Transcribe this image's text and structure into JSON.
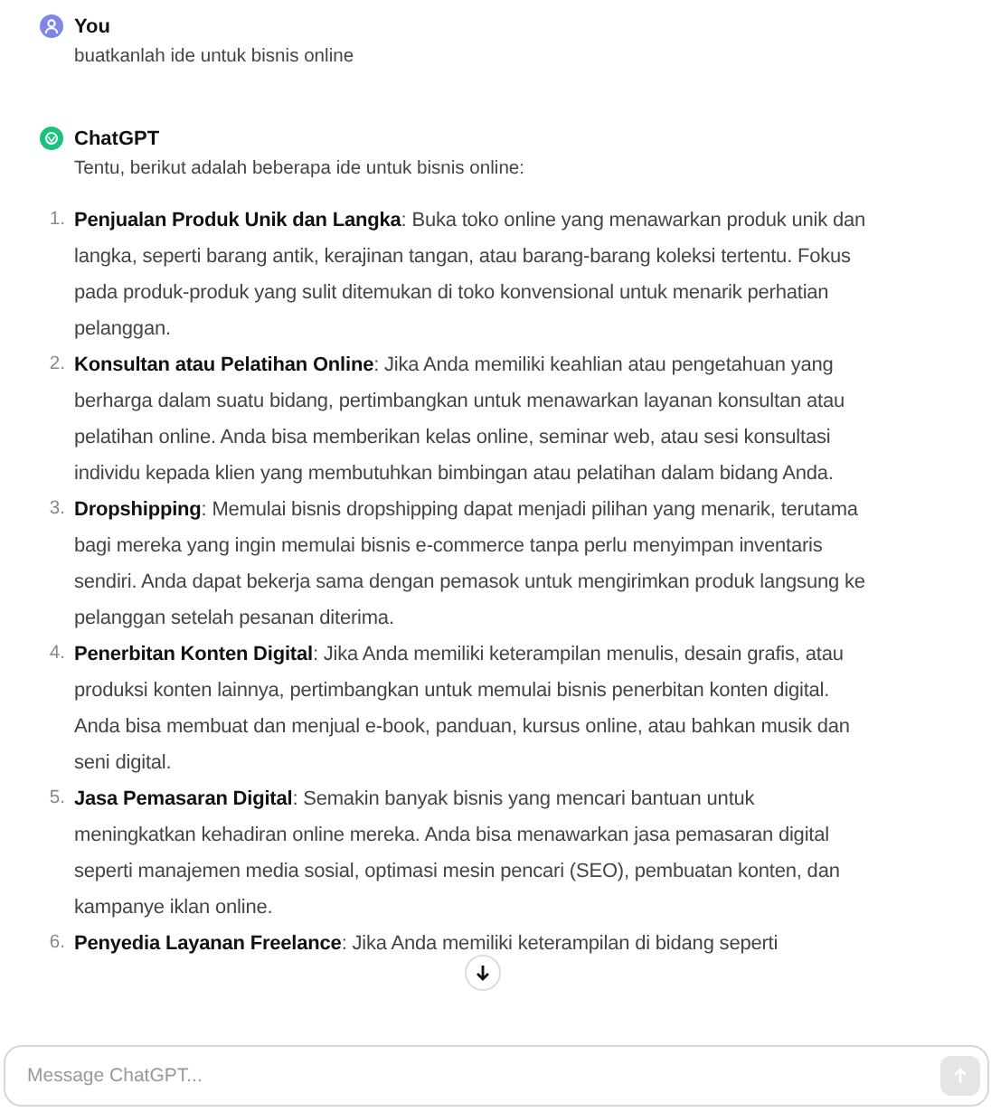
{
  "messages": [
    {
      "kind": "user",
      "author": "You",
      "text": "buatkanlah ide untuk bisnis online"
    },
    {
      "kind": "assistant",
      "author": "ChatGPT",
      "text": "Tentu, berikut adalah beberapa ide untuk bisnis online:",
      "items": [
        {
          "number": "1.",
          "title": "Penjualan Produk Unik dan Langka",
          "text": ": Buka toko online yang menawarkan produk unik dan langka, seperti barang antik, kerajinan tangan, atau barang-barang koleksi tertentu. Fokus pada produk-produk yang sulit ditemukan di toko konvensional untuk menarik perhatian pelanggan."
        },
        {
          "number": "2.",
          "title": "Konsultan atau Pelatihan Online",
          "text": ": Jika Anda memiliki keahlian atau pengetahuan yang berharga dalam suatu bidang, pertimbangkan untuk menawarkan layanan konsultan atau pelatihan online. Anda bisa memberikan kelas online, seminar web, atau sesi konsultasi individu kepada klien yang membutuhkan bimbingan atau pelatihan dalam bidang Anda."
        },
        {
          "number": "3.",
          "title": "Dropshipping",
          "text": ": Memulai bisnis dropshipping dapat menjadi pilihan yang menarik, terutama bagi mereka yang ingin memulai bisnis e-commerce tanpa perlu menyimpan inventaris sendiri. Anda dapat bekerja sama dengan pemasok untuk mengirimkan produk langsung ke pelanggan setelah pesanan diterima."
        },
        {
          "number": "4.",
          "title": "Penerbitan Konten Digital",
          "text": ": Jika Anda memiliki keterampilan menulis, desain grafis, atau produksi konten lainnya, pertimbangkan untuk memulai bisnis penerbitan konten digital. Anda bisa membuat dan menjual e-book, panduan, kursus online, atau bahkan musik dan seni digital."
        },
        {
          "number": "5.",
          "title": "Jasa Pemasaran Digital",
          "text": ": Semakin banyak bisnis yang mencari bantuan untuk meningkatkan kehadiran online mereka. Anda bisa menawarkan jasa pemasaran digital seperti manajemen media sosial, optimasi mesin pencari (SEO), pembuatan konten, dan kampanye iklan online."
        },
        {
          "number": "6.",
          "title": "Penyedia Layanan Freelance",
          "text": ": Jika Anda memiliki keterampilan di bidang seperti"
        }
      ]
    }
  ],
  "composer": {
    "placeholder": "Message ChatGPT...",
    "send_disabled": true
  }
}
